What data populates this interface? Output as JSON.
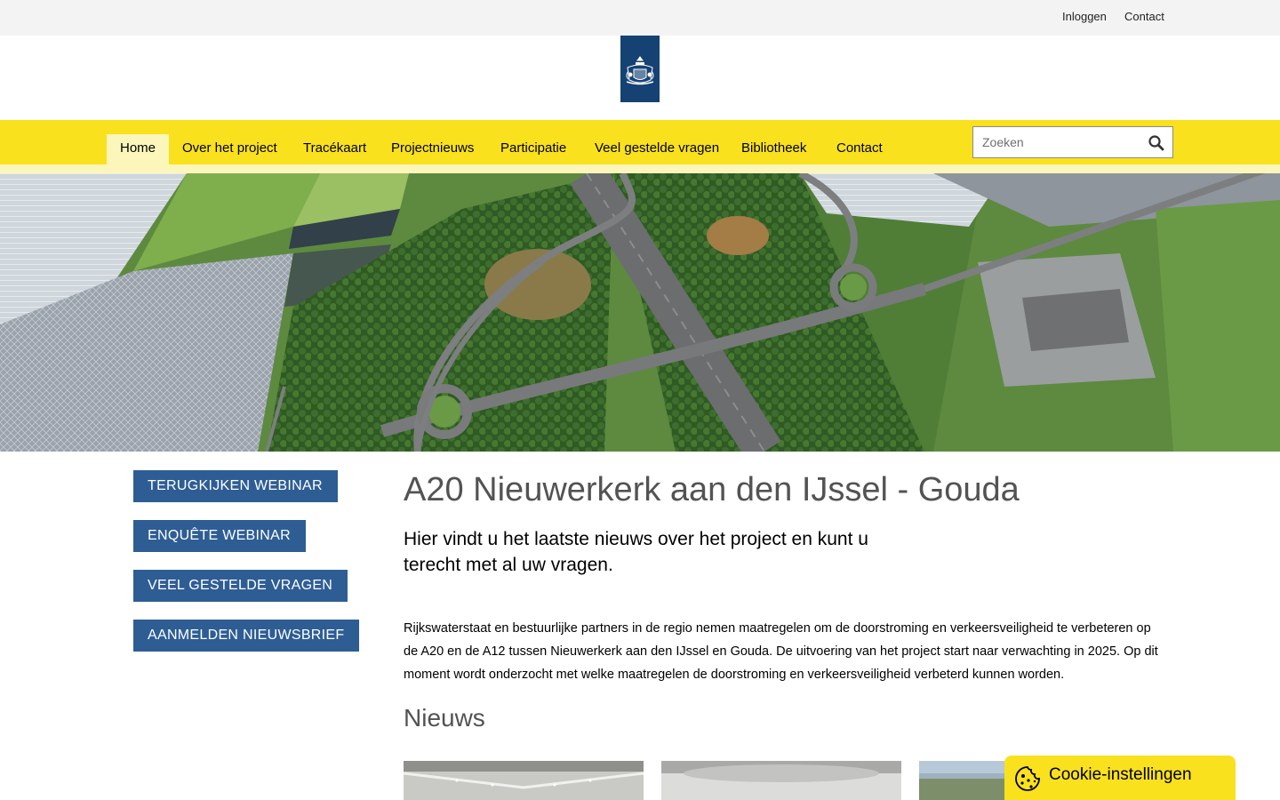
{
  "topbar": {
    "login_label": "Inloggen",
    "contact_label": "Contact"
  },
  "nav": {
    "items": [
      {
        "label": "Home",
        "active": true
      },
      {
        "label": "Over het project",
        "active": false
      },
      {
        "label": "Tracékaart",
        "active": false
      },
      {
        "label": "Projectnieuws",
        "active": false
      },
      {
        "label": "Participatie",
        "active": false
      },
      {
        "label": "Veel gestelde vragen",
        "active": false
      },
      {
        "label": "Bibliotheek",
        "active": false
      },
      {
        "label": "Contact",
        "active": false
      }
    ],
    "search_placeholder": "Zoeken"
  },
  "quick_links": [
    {
      "label": "TERUGKIJKEN WEBINAR"
    },
    {
      "label": "ENQUÊTE WEBINAR"
    },
    {
      "label": "VEEL GESTELDE VRAGEN"
    },
    {
      "label": "AANMELDEN NIEUWSBRIEF"
    }
  ],
  "main": {
    "title": "A20 Nieuwerkerk aan den IJssel - Gouda",
    "intro": "Hier vindt u het laatste nieuws over het project en kunt u terecht met al uw vragen.",
    "body": "Rijkswaterstaat en bestuurlijke partners in de regio nemen maatregelen om de doorstroming en verkeersveiligheid te verbeteren op de A20 en de A12 tussen Nieuwerkerk aan den IJssel en Gouda. De uitvoering van het project start naar verwachting in 2025. Op dit moment wordt onderzocht met welke maatregelen de doorstroming en verkeersveiligheid verbeterd kunnen worden.",
    "news_heading": "Nieuws"
  },
  "cookie": {
    "label": "Cookie-instellingen"
  },
  "colors": {
    "nav_yellow": "#f9e11e",
    "nav_light": "#fdf6bb",
    "button_blue": "#2e5d94",
    "logo_blue": "#154273"
  }
}
